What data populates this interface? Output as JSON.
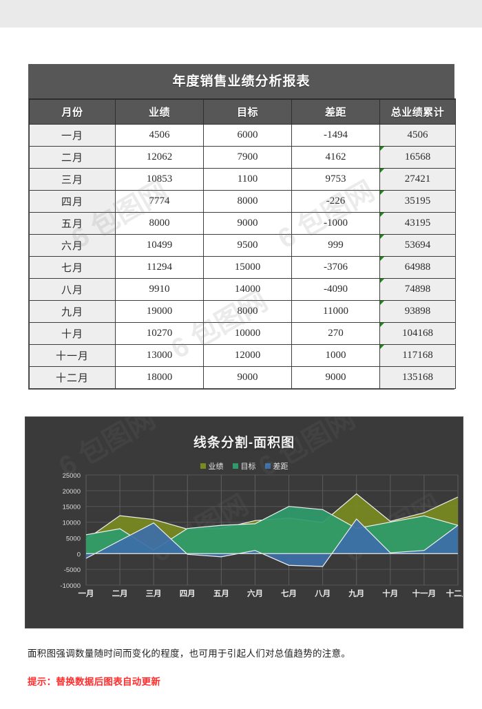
{
  "table": {
    "title": "年度销售业绩分析报表",
    "columns": [
      "月份",
      "业绩",
      "目标",
      "差距",
      "总业绩累计"
    ],
    "rows": [
      {
        "month": "一月",
        "perf": "4506",
        "goal": "6000",
        "gap": "-1494",
        "cum": "4506",
        "flag": false
      },
      {
        "month": "二月",
        "perf": "12062",
        "goal": "7900",
        "gap": "4162",
        "cum": "16568",
        "flag": true
      },
      {
        "month": "三月",
        "perf": "10853",
        "goal": "1100",
        "gap": "9753",
        "cum": "27421",
        "flag": true
      },
      {
        "month": "四月",
        "perf": "7774",
        "goal": "8000",
        "gap": "-226",
        "cum": "35195",
        "flag": true
      },
      {
        "month": "五月",
        "perf": "8000",
        "goal": "9000",
        "gap": "-1000",
        "cum": "43195",
        "flag": true
      },
      {
        "month": "六月",
        "perf": "10499",
        "goal": "9500",
        "gap": "999",
        "cum": "53694",
        "flag": true
      },
      {
        "month": "七月",
        "perf": "11294",
        "goal": "15000",
        "gap": "-3706",
        "cum": "64988",
        "flag": true
      },
      {
        "month": "八月",
        "perf": "9910",
        "goal": "14000",
        "gap": "-4090",
        "cum": "74898",
        "flag": true
      },
      {
        "month": "九月",
        "perf": "19000",
        "goal": "8000",
        "gap": "11000",
        "cum": "93898",
        "flag": true
      },
      {
        "month": "十月",
        "perf": "10270",
        "goal": "10000",
        "gap": "270",
        "cum": "104168",
        "flag": true
      },
      {
        "month": "十一月",
        "perf": "13000",
        "goal": "12000",
        "gap": "1000",
        "cum": "117168",
        "flag": true
      },
      {
        "month": "十二月",
        "perf": "18000",
        "goal": "9000",
        "gap": "9000",
        "cum": "135168",
        "flag": false
      }
    ]
  },
  "chart_data": {
    "type": "area",
    "title": "线条分割-面积图",
    "xlabel": "",
    "ylabel": "",
    "grid": true,
    "legend_position": "top",
    "ylim": [
      -10000,
      25000
    ],
    "yticks": [
      25000,
      20000,
      15000,
      10000,
      5000,
      0,
      -5000,
      -10000
    ],
    "ytick_labels": [
      "25000",
      "20000",
      "15000",
      "10000",
      "5000",
      "0",
      "-5000",
      "-10000"
    ],
    "categories": [
      "一月",
      "二月",
      "三月",
      "四月",
      "五月",
      "六月",
      "七月",
      "八月",
      "九月",
      "十月",
      "十一月",
      "十二月"
    ],
    "series": [
      {
        "name": "业绩",
        "color": "#7a8a21",
        "values": [
          4506,
          12062,
          10853,
          7774,
          8000,
          10499,
          11294,
          9910,
          19000,
          10270,
          13000,
          18000
        ]
      },
      {
        "name": "目标",
        "color": "#2e9b6b",
        "values": [
          6000,
          7900,
          1100,
          8000,
          9000,
          9500,
          15000,
          14000,
          8000,
          10000,
          12000,
          9000
        ]
      },
      {
        "name": "差距",
        "color": "#3d6fa8",
        "values": [
          -1494,
          4162,
          9753,
          -226,
          -1000,
          999,
          -3706,
          -4090,
          11000,
          270,
          1000,
          9000
        ]
      }
    ]
  },
  "footer": {
    "note": "面积图强调数量随时间而变化的程度，也可用于引起人们对总值趋势的注意。",
    "tip": "提示：替换数据后图表自动更新"
  },
  "colors": {
    "panel_dark": "#575757",
    "chart_bg": "#3a3a3a",
    "series_performance": "#7a8a21",
    "series_goal": "#2e9b6b",
    "series_gap": "#3d6fa8",
    "tip_red": "#ff2e2e"
  }
}
